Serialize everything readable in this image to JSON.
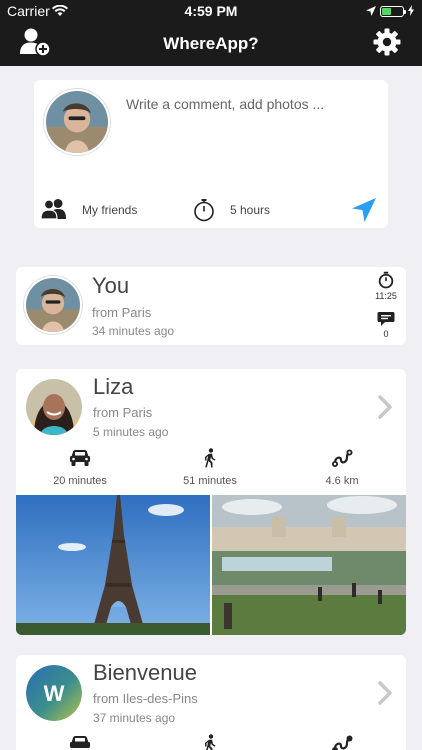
{
  "status_bar": {
    "carrier": "Carrier",
    "time": "4:59 PM"
  },
  "nav": {
    "title": "WhereApp?",
    "left_icon": "add-friend-icon",
    "right_icon": "gear-icon"
  },
  "compose": {
    "placeholder": "Write a comment, add photos ...",
    "friends_label": "My friends",
    "duration_label": "5 hours",
    "send_icon": "location-arrow-icon"
  },
  "you": {
    "name": "You",
    "from": "from Paris",
    "ago": "34 minutes ago",
    "timer_value": "11:25",
    "comments_count": "0"
  },
  "entries": [
    {
      "name": "Liza",
      "from": "from Paris",
      "ago": "5 minutes ago",
      "car": "20 minutes",
      "walk": "51 minutes",
      "bike": "4.6 km"
    },
    {
      "name": "Bienvenue",
      "from": "from Iles-des-Pins",
      "ago": "37 minutes ago",
      "avatar_letter": "W"
    }
  ],
  "colors": {
    "header": "#1b1b1b",
    "background": "#efeff4",
    "accent": "#2a9df4",
    "battery": "#4cd964"
  }
}
